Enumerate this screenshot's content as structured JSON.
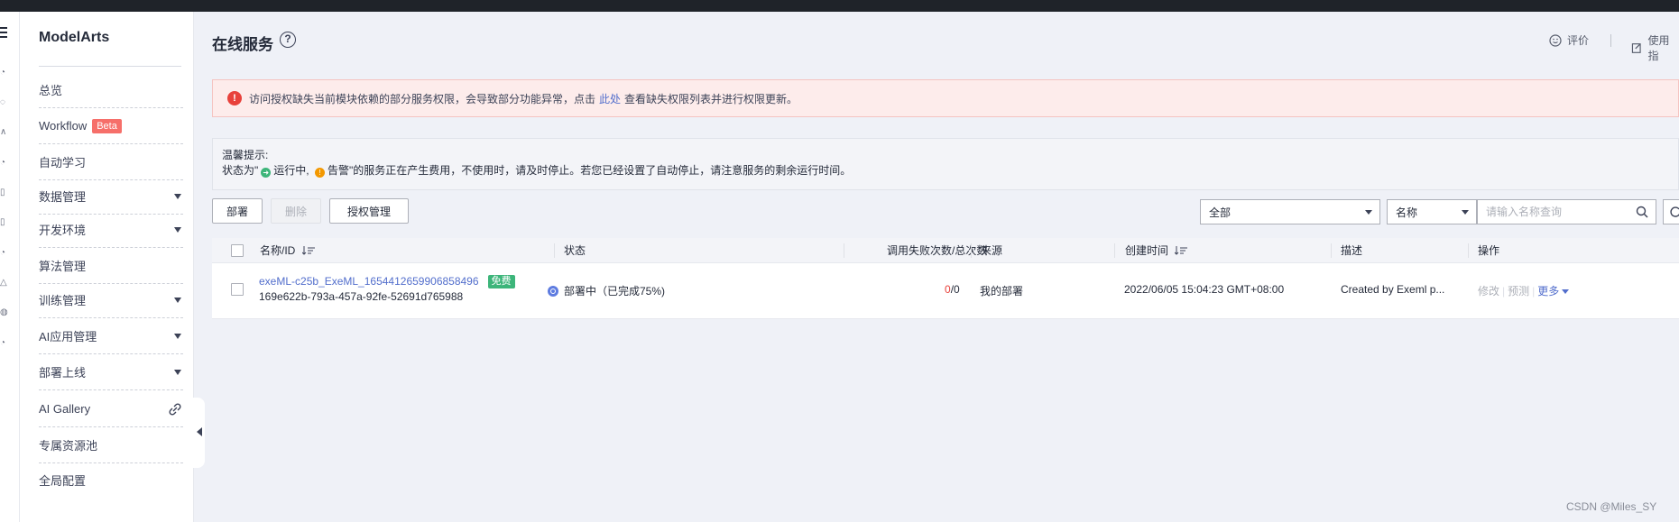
{
  "colors": {
    "accent": "#526ecc",
    "danger": "#e8413b",
    "success": "#3db57a",
    "beta": "#f66f6a"
  },
  "sidebar": {
    "brand": "ModelArts",
    "items": [
      {
        "label": "总览"
      },
      {
        "label": "Workflow",
        "badge": "Beta"
      },
      {
        "label": "自动学习"
      },
      {
        "label": "数据管理"
      },
      {
        "label": "开发环境"
      },
      {
        "label": "算法管理"
      },
      {
        "label": "训练管理"
      },
      {
        "label": "AI应用管理"
      },
      {
        "label": "部署上线"
      },
      {
        "label": "AI Gallery"
      },
      {
        "label": "专属资源池"
      },
      {
        "label": "全局配置"
      }
    ]
  },
  "header": {
    "title": "在线服务",
    "rate_label": "评价",
    "guide_label": "使用指"
  },
  "alert": {
    "text_before": "访问授权缺失当前模块依赖的部分服务权限，会导致部分功能异常，点击",
    "link": "此处",
    "text_after": "查看缺失权限列表并进行权限更新。"
  },
  "tips": {
    "title": "温馨提示:",
    "prefix": "状态为\"",
    "running": "运行中,",
    "alarm": "告警",
    "rest": "\"的服务正在产生费用，不使用时，请及时停止。若您已经设置了自动停止，请注意服务的剩余运行时间。"
  },
  "toolbar": {
    "deploy": "部署",
    "delete": "删除",
    "auth": "授权管理",
    "filter_status": "全部",
    "filter_field": "名称",
    "search_placeholder": "请输入名称查询"
  },
  "table": {
    "headers": {
      "name": "名称/ID",
      "status": "状态",
      "calls": "调用失败次数/总次数",
      "source": "来源",
      "created": "创建时间",
      "desc": "描述",
      "ops": "操作"
    },
    "rows": [
      {
        "name": "exeML-c25b_ExeML_1654412659906858496",
        "badge": "免费",
        "id": "169e622b-793a-457a-92fe-52691d765988",
        "status": "部署中（已完成75%)",
        "fail": "0",
        "total": "/0",
        "source": "我的部署",
        "created": "2022/06/05 15:04:23 GMT+08:00",
        "desc": "Created by Exeml p...",
        "op_edit": "修改",
        "op_predict": "预测",
        "op_more": "更多"
      }
    ]
  },
  "watermark": "CSDN @Miles_SY"
}
